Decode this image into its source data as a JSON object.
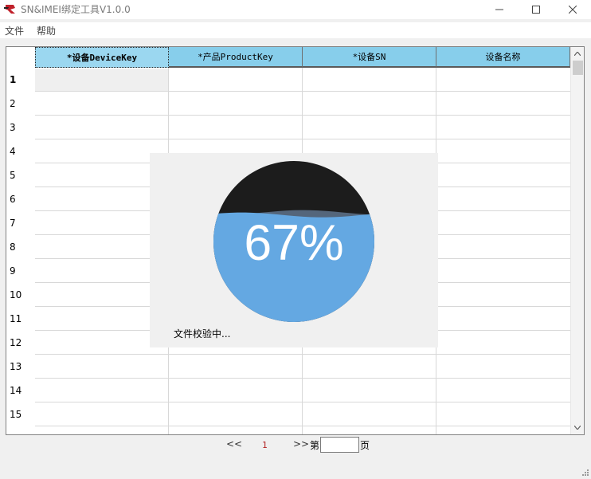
{
  "window": {
    "title": "SN&IMEI绑定工具V1.0.0",
    "icons": {
      "app": "app-logo-icon",
      "minimize": "minimize-icon",
      "maximize": "maximize-icon",
      "close": "close-icon"
    }
  },
  "menu": {
    "file": "文件",
    "help": "帮助"
  },
  "table": {
    "columns": [
      "*设备DeviceKey",
      "*产品ProductKey",
      "*设备SN",
      "设备名称"
    ],
    "row_numbers": [
      "1",
      "2",
      "3",
      "4",
      "5",
      "6",
      "7",
      "8",
      "9",
      "10",
      "11",
      "12",
      "13",
      "14",
      "15"
    ],
    "selected_row": "1"
  },
  "progress": {
    "percent_text": "67%",
    "fraction": 0.67,
    "status_text": "文件校验中...",
    "fill_color": "#64a8e2",
    "empty_color": "#1c1c1c"
  },
  "pagination": {
    "prev_label": "<<",
    "current_page": "1",
    "next_label": ">>",
    "goto_prefix": "第",
    "goto_value": "",
    "goto_suffix": "页"
  },
  "colors": {
    "header_bg": "#87ceeb",
    "accent": "#64a8e2",
    "page_number": "#b22222"
  }
}
